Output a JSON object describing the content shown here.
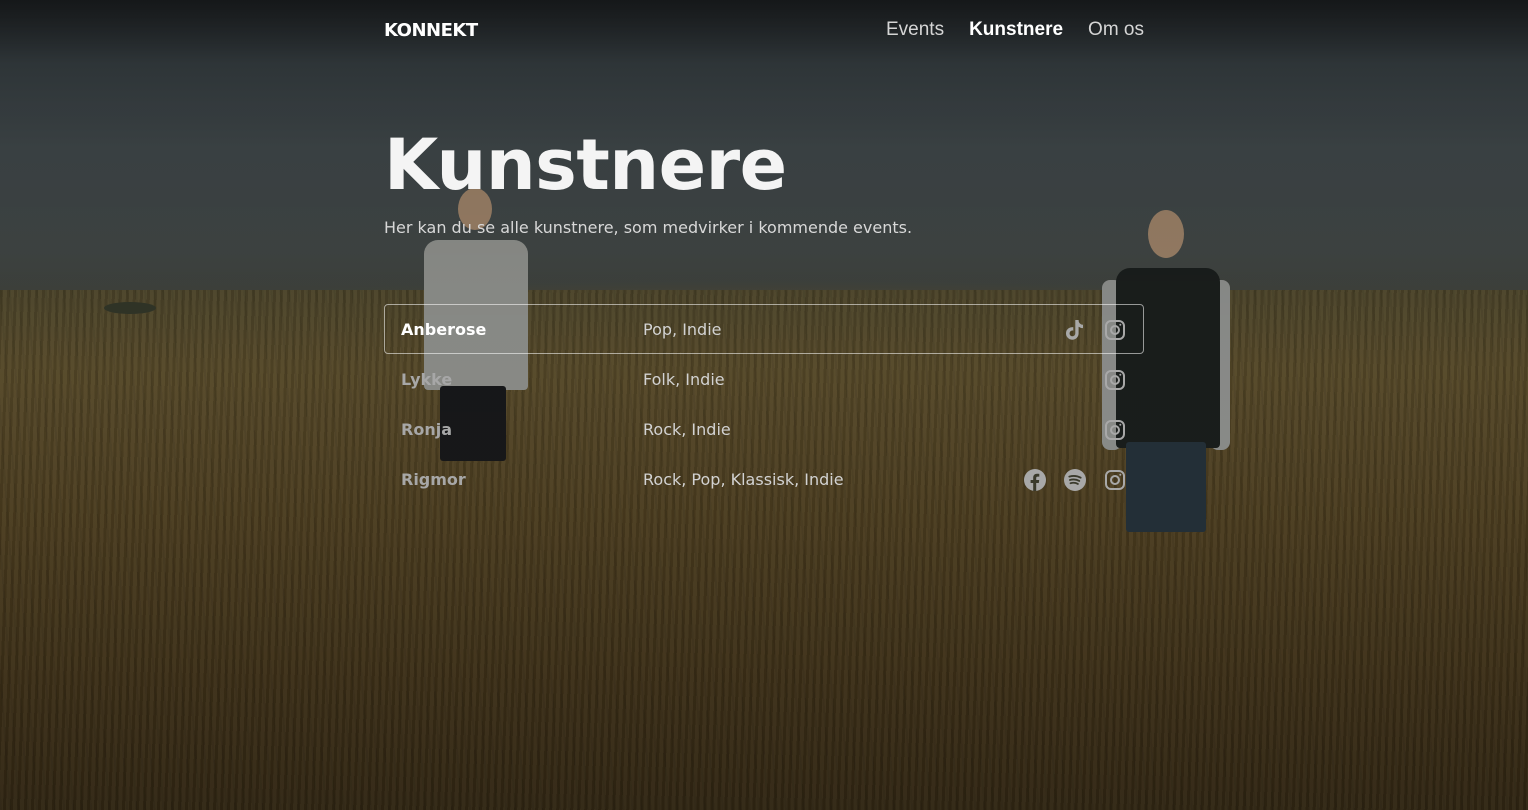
{
  "header": {
    "logo": "KONNEKT",
    "nav": [
      {
        "label": "Events",
        "active": false
      },
      {
        "label": "Kunstnere",
        "active": true
      },
      {
        "label": "Om os",
        "active": false
      }
    ]
  },
  "hero": {
    "title": "Kunstnere",
    "subtitle": "Her kan du se alle kunstnere, som medvirker i kommende events."
  },
  "artists": [
    {
      "name": "Anberose",
      "genres": "Pop, Indie",
      "selected": true,
      "social": [
        "tiktok-icon",
        "instagram-icon"
      ]
    },
    {
      "name": "Lykke",
      "genres": "Folk, Indie",
      "selected": false,
      "social": [
        "instagram-icon"
      ]
    },
    {
      "name": "Ronja",
      "genres": "Rock, Indie",
      "selected": false,
      "social": [
        "instagram-icon"
      ]
    },
    {
      "name": "Rigmor",
      "genres": "Rock, Pop, Klassisk, Indie",
      "selected": false,
      "social": [
        "facebook-icon",
        "spotify-icon",
        "instagram-icon"
      ]
    }
  ],
  "colors": {
    "text_primary": "#ffffff",
    "text_muted": "#a7a7a7",
    "icon": "#a8a8a8"
  }
}
